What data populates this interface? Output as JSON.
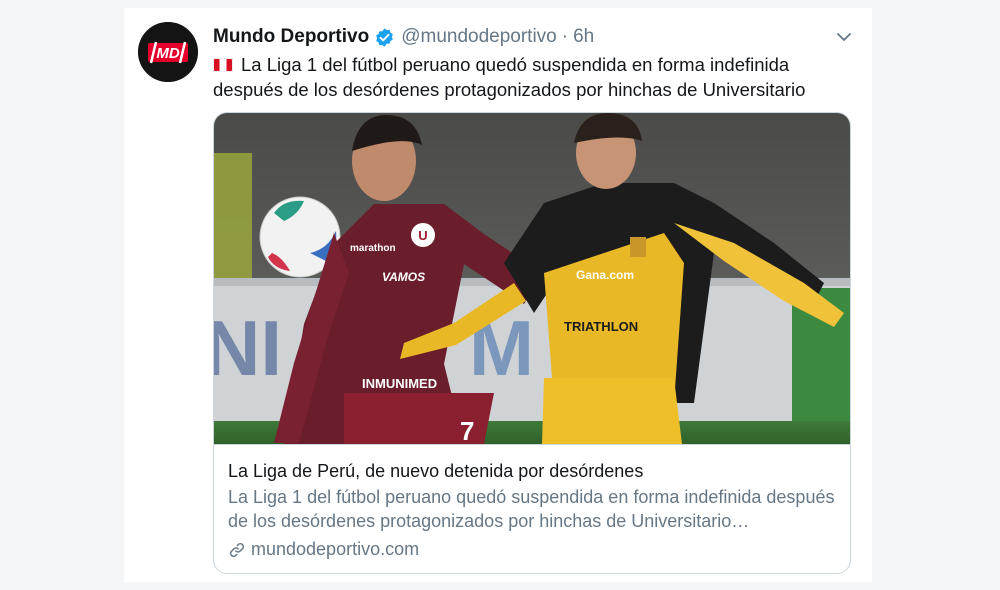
{
  "tweet": {
    "display_name": "Mundo Deportivo",
    "handle": "@mundodeportivo",
    "separator": "·",
    "time": "6h",
    "text_line1": "La Liga 1 del fútbol peruano quedó suspendida en forma indefinida",
    "text_line2": "después de los desórdenes protagonizados por hinchas de Universitario",
    "avatar_logo": "MD"
  },
  "card": {
    "title": "La Liga de Perú, de nuevo detenida por desórdenes",
    "description": "La Liga 1 del fútbol peruano quedó suspendida en forma indefinida después de los desórdenes protagonizados por hinchas de Universitario…",
    "domain": "mundodeportivo.com",
    "image": {
      "jersey_left_number": "7",
      "jersey_left_sponsor": "INMUNIMED",
      "jersey_left_chest": "VAMOS",
      "jersey_left_brand": "marathon",
      "jersey_right_sponsor": "Gana.com",
      "jersey_right_sponsor2": "TRIATHLON"
    }
  },
  "icons": {
    "verified": "verified-badge-icon",
    "more": "chevron-down-icon",
    "link": "link-icon",
    "flag": "peru-flag-icon"
  },
  "colors": {
    "verified": "#1da1f2",
    "text": "#14171a",
    "muted": "#657786",
    "border": "#ccd6dd"
  }
}
